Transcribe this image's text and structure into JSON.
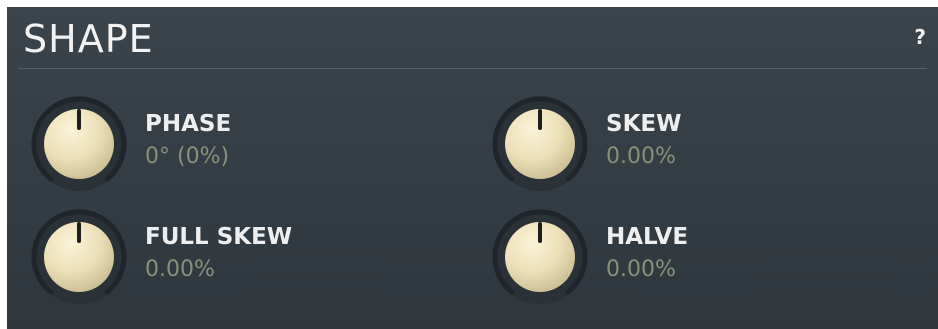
{
  "section": {
    "title": "SHAPE",
    "help_label": "?"
  },
  "knobs": [
    {
      "label": "PHASE",
      "value": "0° (0%)",
      "position": 0.5
    },
    {
      "label": "SKEW",
      "value": "0.00%",
      "position": 0.5
    },
    {
      "label": "FULL SKEW",
      "value": "0.00%",
      "position": 0.5
    },
    {
      "label": "HALVE",
      "value": "0.00%",
      "position": 0.5
    }
  ],
  "colors": {
    "panel": "#353e45",
    "knob_cap": "#ece0b8",
    "value_text": "#8a8f79"
  }
}
